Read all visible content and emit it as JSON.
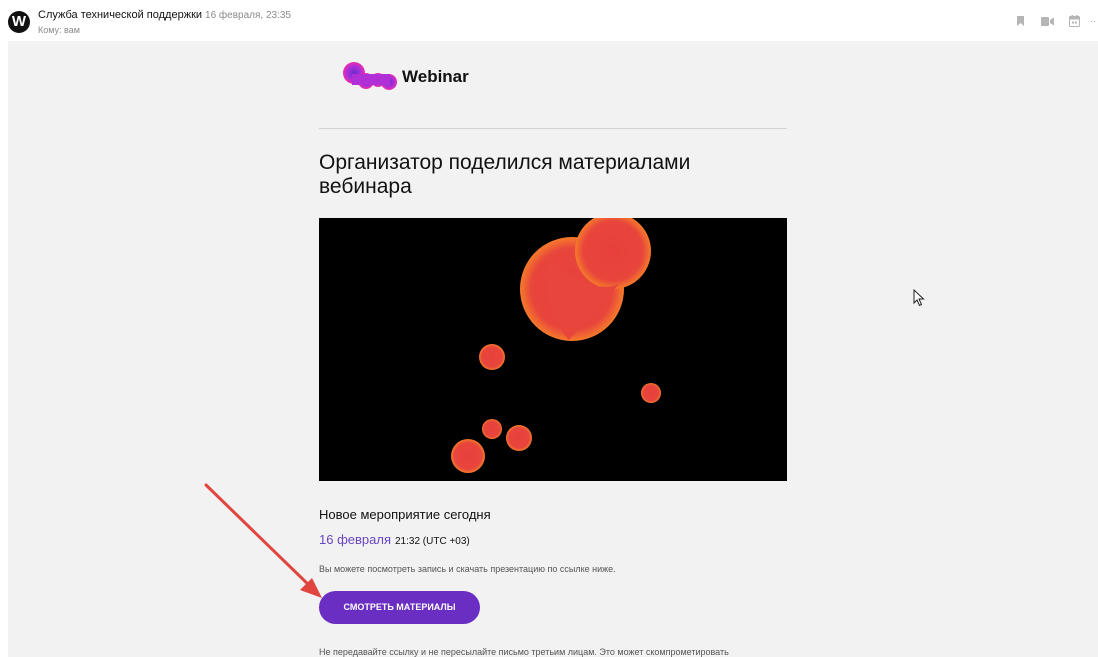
{
  "header": {
    "avatar_letter": "W",
    "sender": "Служба технической поддержки",
    "date": "16 февраля, 23:35",
    "recipient": "Кому: вам",
    "tools": [
      "bookmark-icon",
      "video-icon",
      "calendar-icon",
      "more-icon"
    ],
    "more_label": "··"
  },
  "email": {
    "logo_text": "Webinar",
    "title": "Организатор поделился материалами вебинара",
    "event_heading": "Новое мероприятие сегодня",
    "event_date": "16 февраля",
    "event_time": "21:32 (UTC +03)",
    "note": "Вы можете посмотреть запись и скачать презентацию по ссылке ниже.",
    "button_label": "СМОТРЕТЬ МАТЕРИАЛЫ",
    "footer_note": "Не передавайте ссылку и не пересылайте письмо третьим лицам. Это может скомпрометировать"
  },
  "colors": {
    "accent": "#6a2ec2",
    "date_link": "#6a45c4",
    "blob_fill": "#e8453c",
    "blob_rim": "#f57a2a",
    "banner_bg": "#000000",
    "annotation_arrow": "#e0463f"
  }
}
